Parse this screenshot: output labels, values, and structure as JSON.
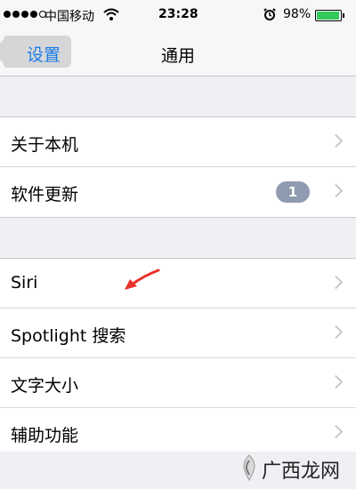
{
  "status_bar": {
    "carrier": "中国移动",
    "time": "23:28",
    "battery": "98%",
    "battery_level": 0.98,
    "battery_color": "#34c759",
    "icons": [
      "signal-dots-icon",
      "wifi-icon",
      "alarm-icon",
      "battery-icon"
    ]
  },
  "nav": {
    "back_label": "设置",
    "title": "通用",
    "accent_color": "#1a7be6"
  },
  "groups": [
    {
      "rows": [
        {
          "label": "关于本机"
        },
        {
          "label": "软件更新",
          "badge": "1"
        }
      ]
    },
    {
      "rows": [
        {
          "label": "Siri"
        },
        {
          "label": "Spotlight 搜索"
        },
        {
          "label": "文字大小"
        },
        {
          "label": "辅助功能"
        }
      ]
    }
  ],
  "annotation": {
    "icon": "red-arrow-icon",
    "color": "#e8322a"
  },
  "watermark": {
    "text": "广西龙网",
    "icon": "watermark-logo-icon"
  }
}
